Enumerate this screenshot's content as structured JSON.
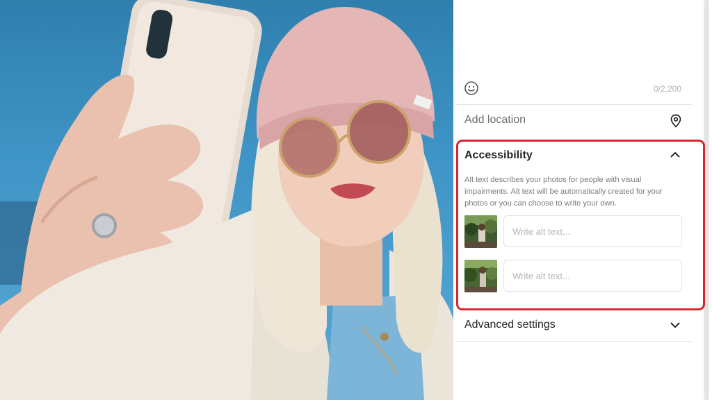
{
  "caption": {
    "emoji_icon": "smiley-icon",
    "char_counter": "0/2,200"
  },
  "location": {
    "label": "Add location",
    "icon": "location-pin-icon"
  },
  "accessibility": {
    "title": "Accessibility",
    "toggle_icon": "chevron-up-icon",
    "description": "Alt text describes your photos for people with visual impairments. Alt text will be automatically created for your photos or you can choose to write your own.",
    "alt_inputs": [
      {
        "placeholder": "Write alt text...",
        "value": ""
      },
      {
        "placeholder": "Write alt text...",
        "value": ""
      }
    ],
    "highlight_color": "#d7262e"
  },
  "advanced": {
    "title": "Advanced settings",
    "toggle_icon": "chevron-down-icon"
  }
}
